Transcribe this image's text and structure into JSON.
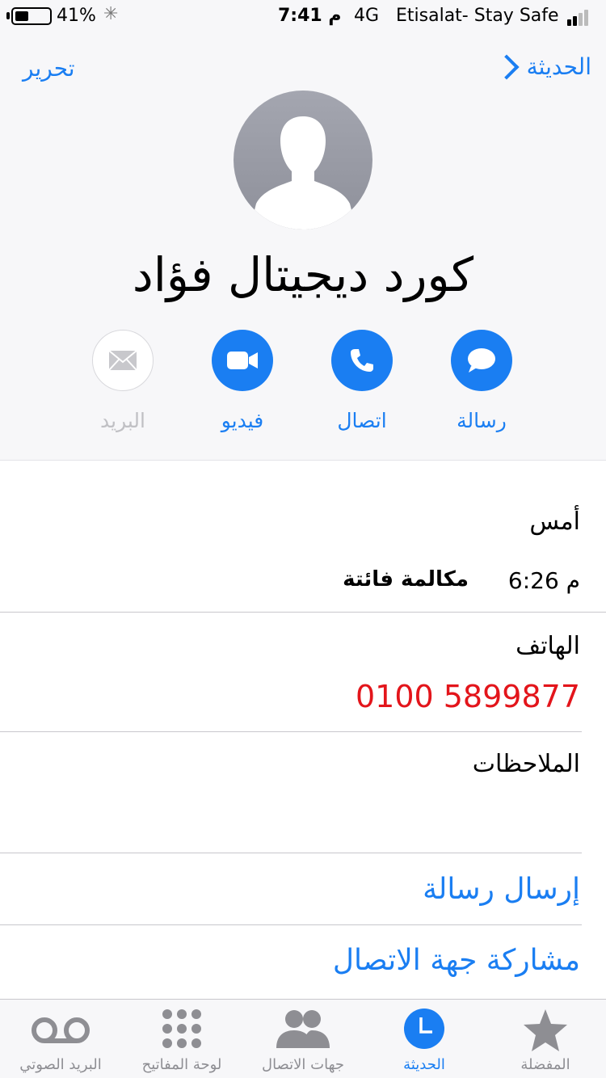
{
  "status_bar": {
    "battery_percent": "41%",
    "battery_level": 0.41,
    "time": "7:41 م",
    "network": "4G",
    "carrier": "Etisalat- Stay Safe"
  },
  "nav": {
    "back_label": "الحديثة",
    "edit_label": "تحرير"
  },
  "contact": {
    "name": "كورد ديجيتال فؤاد"
  },
  "actions": [
    {
      "label": "رسالة",
      "icon": "message-icon",
      "enabled": true
    },
    {
      "label": "اتصال",
      "icon": "phone-icon",
      "enabled": true
    },
    {
      "label": "فيديو",
      "icon": "video-icon",
      "enabled": true
    },
    {
      "label": "البريد",
      "icon": "mail-icon",
      "enabled": false
    }
  ],
  "recent": {
    "day": "أمس",
    "time": "6:26 م",
    "call_type": "مكالمة فائتة"
  },
  "phone": {
    "label": "الهاتف",
    "number": "0100 5899877"
  },
  "notes": {
    "label": "الملاحظات"
  },
  "links": {
    "send_message": "إرسال رسالة",
    "share_contact": "مشاركة جهة الاتصال"
  },
  "tabs": [
    {
      "label": "المفضلة",
      "icon": "star-icon",
      "active": false
    },
    {
      "label": "الحديثة",
      "icon": "clock-icon",
      "active": true
    },
    {
      "label": "جهات الاتصال",
      "icon": "contacts-icon",
      "active": false
    },
    {
      "label": "لوحة المفاتيح",
      "icon": "keypad-icon",
      "active": false
    },
    {
      "label": "البريد الصوتي",
      "icon": "voicemail-icon",
      "active": false
    }
  ],
  "colors": {
    "accent": "#1a7ef2",
    "missed": "#e3151b",
    "inactive": "#8e8e93"
  }
}
